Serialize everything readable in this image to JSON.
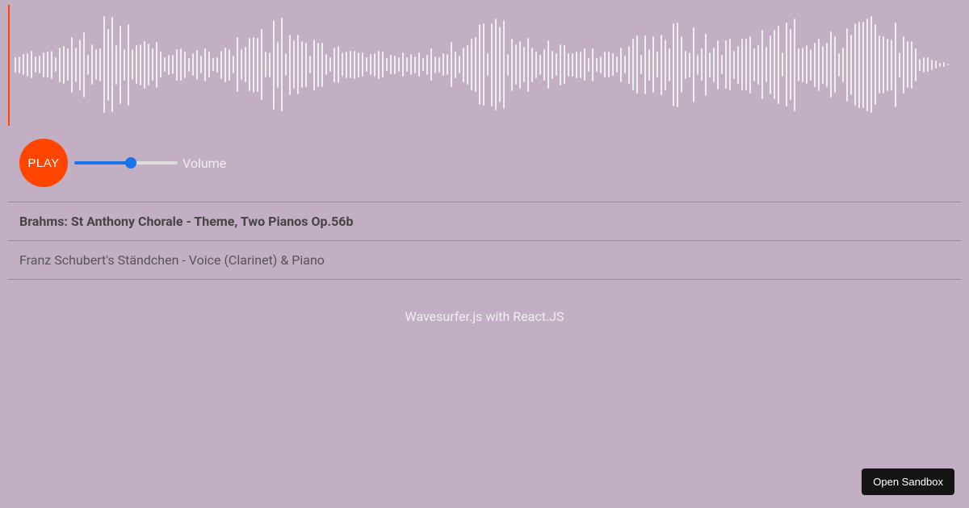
{
  "controls": {
    "play_label": "PLAY",
    "volume_label": "Volume",
    "volume_value": 55
  },
  "tracks": [
    {
      "title": "Brahms: St Anthony Chorale - Theme, Two Pianos Op.56b",
      "active": true
    },
    {
      "title": "Franz Schubert's Ständchen - Voice (Clarinet) & Piano",
      "active": false
    }
  ],
  "footer": "Wavesurfer.js with React.JS",
  "sandbox_button": "Open Sandbox",
  "colors": {
    "background": "#c3afc3",
    "accent": "#ff4500",
    "wave": "#eee",
    "slider": "#1a73e8"
  }
}
